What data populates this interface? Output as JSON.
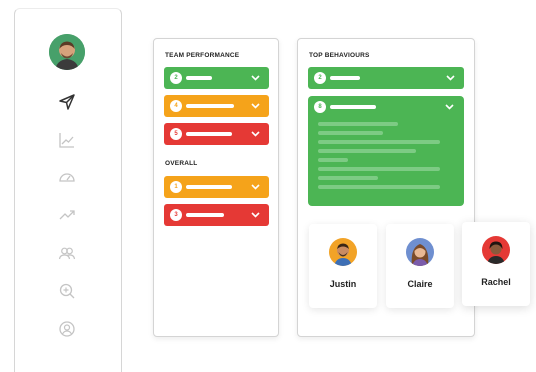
{
  "sidebar": {
    "icons": [
      "send-icon",
      "trend-chart-icon",
      "speedometer-icon",
      "trending-up-icon",
      "users-icon",
      "search-plus-icon",
      "user-circle-icon"
    ]
  },
  "team_performance": {
    "title": "TEAM PERFORMANCE",
    "rows": [
      {
        "number": "2",
        "color": "#4cb554"
      },
      {
        "number": "4",
        "color": "#f5a31a"
      },
      {
        "number": "5",
        "color": "#e53935"
      }
    ]
  },
  "overall": {
    "title": "OVERALL",
    "rows": [
      {
        "number": "1",
        "color": "#f5a31a"
      },
      {
        "number": "3",
        "color": "#e53935"
      }
    ]
  },
  "top_behaviours": {
    "title": "TOP BEHAVIOURS",
    "rows": [
      {
        "number": "2",
        "color": "#4cb554"
      },
      {
        "number": "8",
        "color": "#4cb554"
      }
    ]
  },
  "people": [
    {
      "name": "Justin"
    },
    {
      "name": "Claire"
    },
    {
      "name": "Rachel"
    }
  ],
  "colors": {
    "green": "#4cb554",
    "orange": "#f5a31a",
    "red": "#e53935"
  }
}
